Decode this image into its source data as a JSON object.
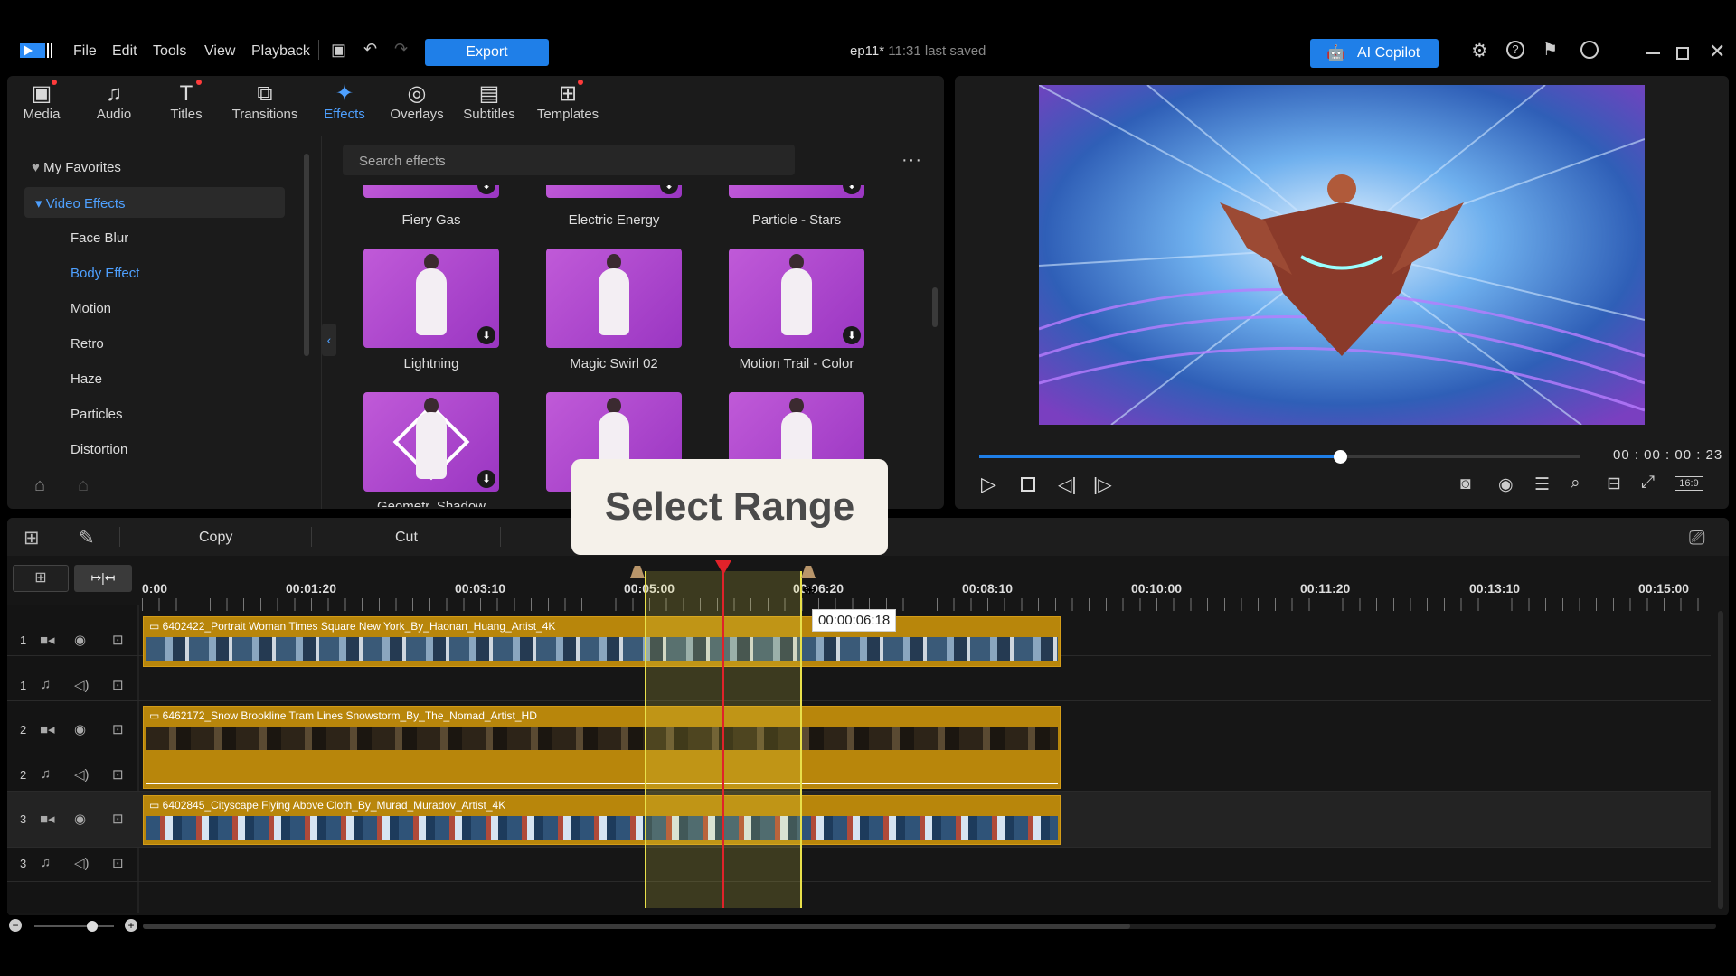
{
  "menu": [
    "File",
    "Edit",
    "Tools",
    "View",
    "Playback"
  ],
  "export_label": "Export",
  "project": {
    "name": "ep11*",
    "saved": "11:31 last saved"
  },
  "copilot_label": "AI Copilot",
  "tabs": [
    {
      "label": "Media",
      "icon": "media-icon"
    },
    {
      "label": "Audio",
      "icon": "audio-icon"
    },
    {
      "label": "Titles",
      "icon": "titles-icon"
    },
    {
      "label": "Transitions",
      "icon": "transitions-icon"
    },
    {
      "label": "Effects",
      "icon": "effects-icon"
    },
    {
      "label": "Overlays",
      "icon": "overlays-icon"
    },
    {
      "label": "Subtitles",
      "icon": "subtitles-icon"
    },
    {
      "label": "Templates",
      "icon": "templates-icon"
    }
  ],
  "sidebar": {
    "favorites": "My Favorites",
    "category": "Video Effects",
    "items": [
      "Face Blur",
      "Body Effect",
      "Motion",
      "Retro",
      "Haze",
      "Particles",
      "Distortion"
    ]
  },
  "search_placeholder": "Search effects",
  "effects_row1": [
    "Fiery Gas",
    "Electric Energy",
    "Particle - Stars"
  ],
  "effects_row2": [
    "Lightning",
    "Magic Swirl 02",
    "Motion Trail - Color"
  ],
  "effects_row3": [
    "Geometr. Shadow",
    "",
    ""
  ],
  "preview": {
    "timecode": "00 : 00 : 00 : 23",
    "ratio": "16:9",
    "progress": 0.6
  },
  "callout": "Select Range",
  "toolbar": {
    "copy": "Copy",
    "cut": "Cut"
  },
  "ruler": [
    "0:00",
    "00:01:20",
    "00:03:10",
    "00:05:00",
    "00:06:20",
    "00:08:10",
    "00:10:00",
    "00:11:20",
    "00:13:10",
    "00:15:00"
  ],
  "tooltip": "00:00:06:18",
  "tracks": [
    {
      "num": "1",
      "type": "video",
      "clip": "6402422_Portrait Woman Times Square New York_By_Haonan_Huang_Artist_4K"
    },
    {
      "num": "1",
      "type": "audio"
    },
    {
      "num": "2",
      "type": "video",
      "clip": "6462172_Snow Brookline Tram Lines Snowstorm_By_The_Nomad_Artist_HD"
    },
    {
      "num": "2",
      "type": "audio"
    },
    {
      "num": "3",
      "type": "video",
      "clip": "6402845_Cityscape Flying Above Cloth_By_Murad_Muradov_Artist_4K"
    },
    {
      "num": "3",
      "type": "audio"
    }
  ],
  "colors": {
    "accent": "#1f7fe8",
    "clip": "#b8860b",
    "playhead": "#e0222a",
    "range": "#e8e04a"
  }
}
